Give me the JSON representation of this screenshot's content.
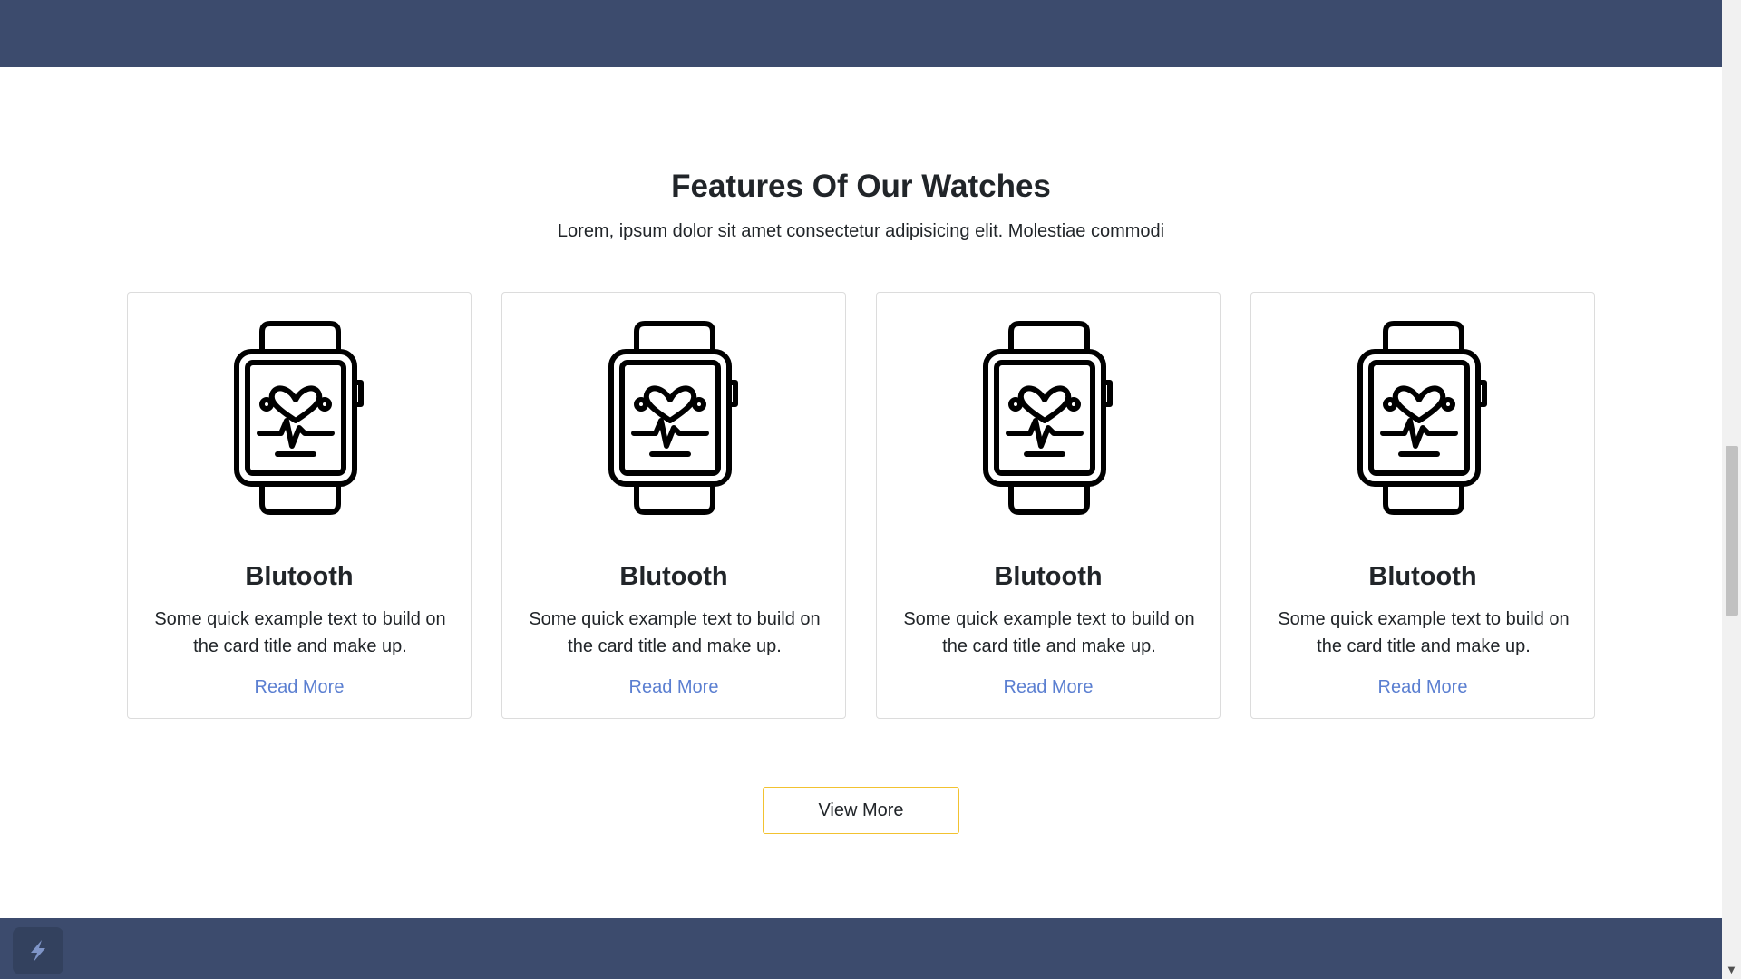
{
  "section": {
    "title": "Features Of Our Watches",
    "subtitle": "Lorem, ipsum dolor sit amet consectetur adipisicing elit. Molestiae commodi"
  },
  "cards": [
    {
      "icon": "smartwatch-heart-rate-icon",
      "title": "Blutooth",
      "text": "Some quick example text to build on the card title and make up.",
      "link": "Read More"
    },
    {
      "icon": "smartwatch-heart-rate-icon",
      "title": "Blutooth",
      "text": "Some quick example text to build on the card title and make up.",
      "link": "Read More"
    },
    {
      "icon": "smartwatch-heart-rate-icon",
      "title": "Blutooth",
      "text": "Some quick example text to build on the card title and make up.",
      "link": "Read More"
    },
    {
      "icon": "smartwatch-heart-rate-icon",
      "title": "Blutooth",
      "text": "Some quick example text to build on the card title and make up.",
      "link": "Read More"
    }
  ],
  "view_more_label": "View More",
  "colors": {
    "band": "#3c4b6d",
    "link": "#5b7fd1",
    "button_border": "#f2c230"
  }
}
